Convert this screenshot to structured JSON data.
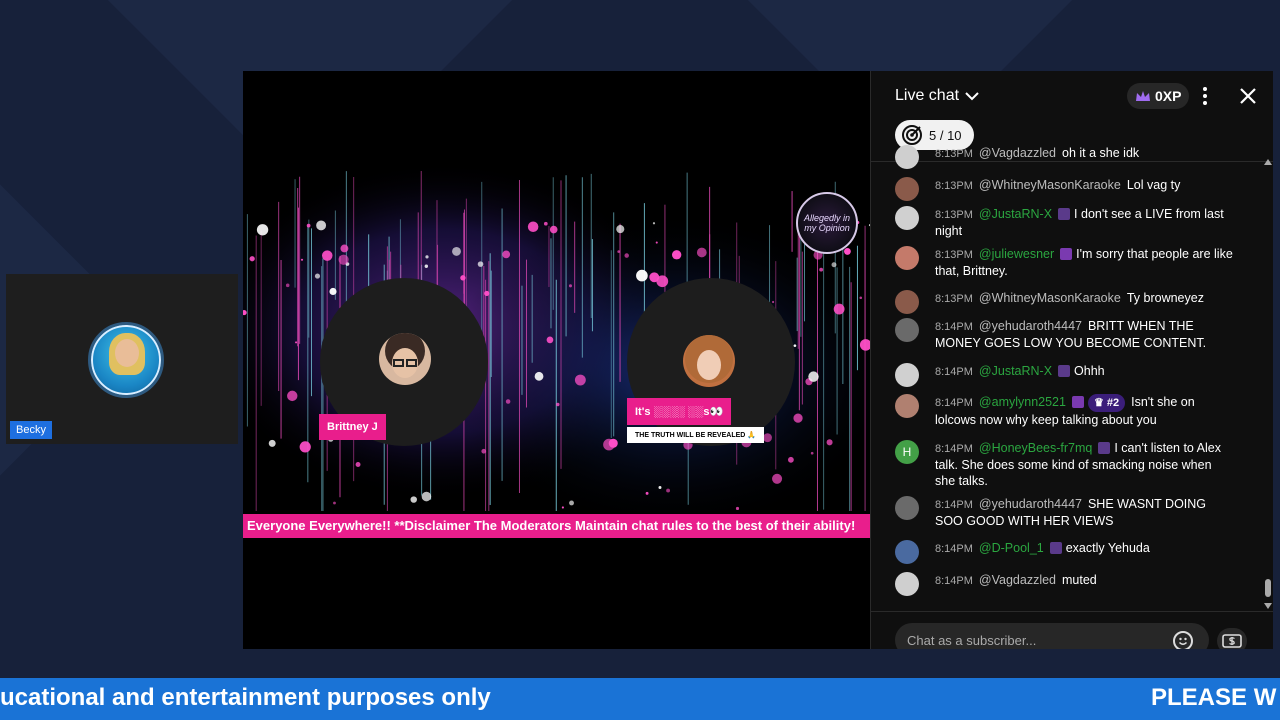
{
  "webcam": {
    "name": "Becky"
  },
  "stage": {
    "host_left_name": "Brittney J",
    "host_right_tag": "It's ░░░░ ░░s👀",
    "host_right_subtitle": "THE TRUTH WILL BE REVEALED 🙏",
    "logo_text": "Allegedly in my Opinion",
    "ticker_text": "Everyone Everywhere!! **Disclaimer The Moderators Maintain chat rules to the best of their ability!",
    "accent_color": "#e91e8c"
  },
  "chat": {
    "title": "Live chat",
    "xp": "0XP",
    "goal": "5 / 10",
    "input_placeholder": "Chat as a subscriber...",
    "messages": [
      {
        "time": "8:13PM",
        "author": "@Vagdazzled",
        "text": "oh it a she idk",
        "member": false,
        "avatar_color": "#cfcfcf"
      },
      {
        "time": "8:13PM",
        "author": "@WhitneyMasonKaraoke",
        "text": "Lol vag ty",
        "member": false,
        "avatar_color": "#8a5a4a"
      },
      {
        "time": "8:13PM",
        "author": "@JustaRN-X",
        "text": "I don't see a LIVE from last night",
        "member": true,
        "avatar_color": "#d0d0d0"
      },
      {
        "time": "8:13PM",
        "author": "@juliewesner",
        "text": "I'm sorry that people are like that, Brittney.",
        "member": true,
        "avatar_color": "#c47a6a"
      },
      {
        "time": "8:13PM",
        "author": "@WhitneyMasonKaraoke",
        "text": "Ty browneyez",
        "member": false,
        "avatar_color": "#8a5a4a"
      },
      {
        "time": "8:14PM",
        "author": "@yehudaroth4447",
        "text": "BRITT WHEN THE MONEY GOES LOW YOU BECOME CONTENT.",
        "member": false,
        "avatar_color": "#6a6a6a"
      },
      {
        "time": "8:14PM",
        "author": "@JustaRN-X",
        "text": "Ohhh",
        "member": true,
        "avatar_color": "#d0d0d0"
      },
      {
        "time": "8:14PM",
        "author": "@amylynn2521",
        "rank": "#2",
        "text": "Isn't she on lolcows now why keep talking about you",
        "member": true,
        "avatar_color": "#b08070"
      },
      {
        "time": "8:14PM",
        "author": "@HoneyBees-fr7mq",
        "text": "I can't listen to Alex talk. She does some kind of smacking noise when she talks.",
        "member": true,
        "avatar_color": "#43a047",
        "avatar_letter": "H"
      },
      {
        "time": "8:14PM",
        "author": "@yehudaroth4447",
        "text": "SHE WASNT DOING SOO GOOD WITH HER VIEWS",
        "member": false,
        "avatar_color": "#6a6a6a"
      },
      {
        "time": "8:14PM",
        "author": "@D-Pool_1",
        "text": "exactly Yehuda",
        "member": true,
        "avatar_color": "#4a6aa0"
      },
      {
        "time": "8:14PM",
        "author": "@Vagdazzled",
        "text": "muted",
        "member": false,
        "avatar_color": "#cfcfcf"
      }
    ]
  },
  "bottom_ticker": {
    "left_text": "ucational and entertainment purposes only",
    "right_text": "PLEASE W"
  }
}
